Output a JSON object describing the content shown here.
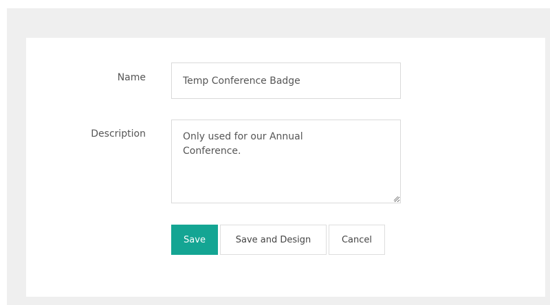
{
  "form": {
    "name_label": "Name",
    "name_value": "Temp Conference Badge",
    "description_label": "Description",
    "description_value": "Only used for our Annual\nConference."
  },
  "actions": {
    "save_label": "Save",
    "save_and_design_label": "Save and Design",
    "cancel_label": "Cancel"
  },
  "colors": {
    "page_background": "#efefef",
    "card_background": "#ffffff",
    "primary_button": "#14a593",
    "field_border": "#d9d9d9",
    "label_text": "#555555"
  }
}
